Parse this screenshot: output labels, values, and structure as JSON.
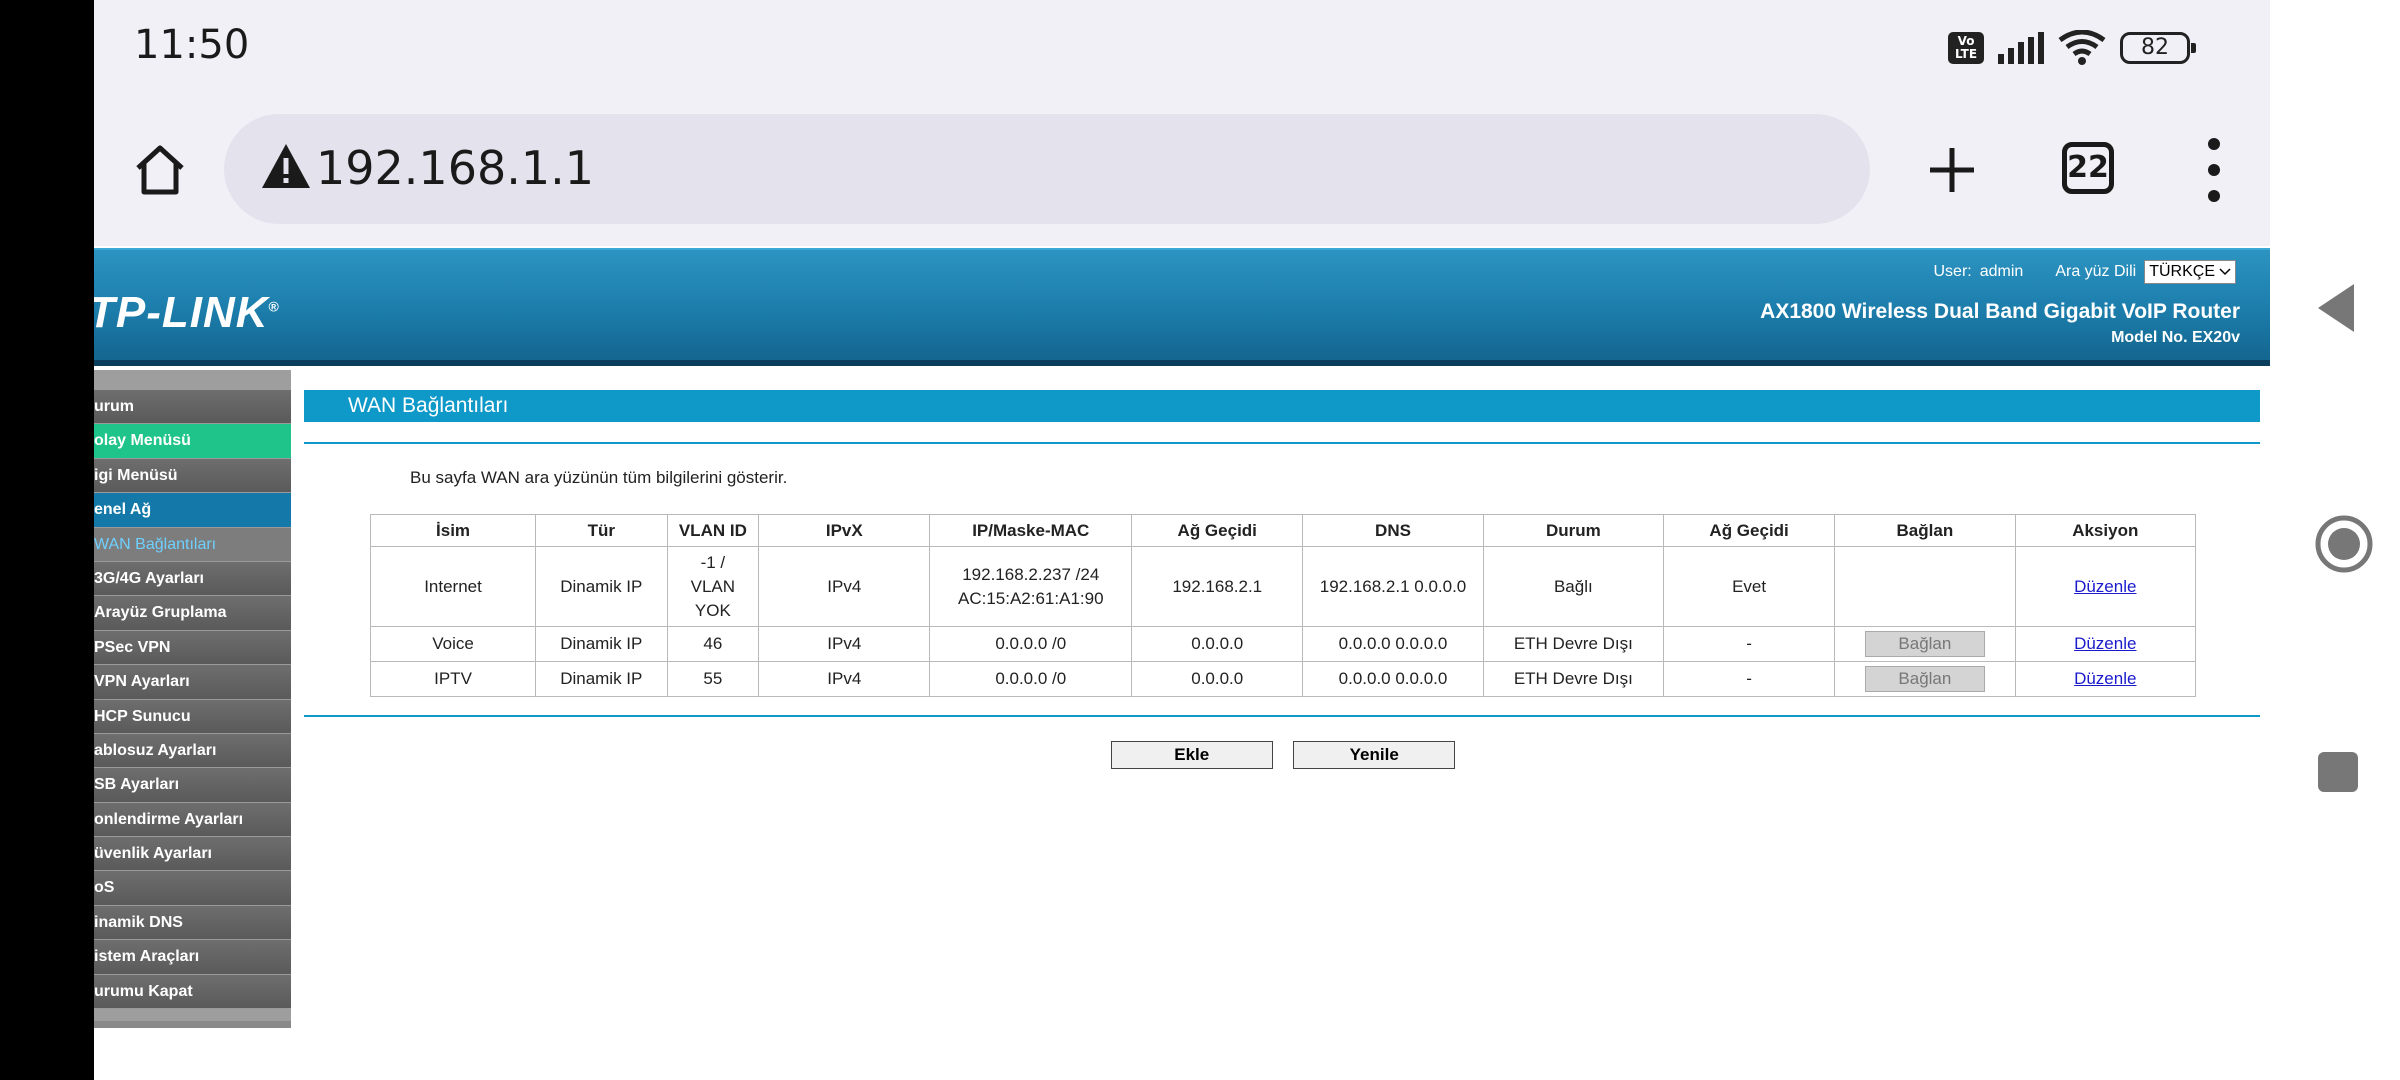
{
  "status_bar": {
    "time": "11:50",
    "volte_label": "Vo LTE",
    "battery": "82"
  },
  "browser": {
    "url": "192.168.1.1",
    "tab_count": "22"
  },
  "router": {
    "user_label": "User:",
    "user_name": "admin",
    "lang_label": "Ara yüz Dili",
    "lang_value": "TÜRKÇE",
    "brand": "TP-LINK",
    "model_title": "AX1800 Wireless Dual Band Gigabit VoIP Router",
    "model_no": "Model No. EX20v"
  },
  "sidebar": {
    "items": [
      {
        "label": "urum",
        "style": "normal"
      },
      {
        "label": "olay Menüsü",
        "style": "green"
      },
      {
        "label": "igi Menüsü",
        "style": "normal"
      },
      {
        "label": "enel Ağ",
        "style": "blue"
      },
      {
        "label": "WAN Bağlantıları",
        "style": "sub"
      },
      {
        "label": "3G/4G Ayarları",
        "style": "normal"
      },
      {
        "label": "Arayüz Gruplama",
        "style": "normal"
      },
      {
        "label": "PSec VPN",
        "style": "normal"
      },
      {
        "label": "VPN Ayarları",
        "style": "normal"
      },
      {
        "label": "HCP Sunucu",
        "style": "normal"
      },
      {
        "label": "ablosuz Ayarları",
        "style": "normal"
      },
      {
        "label": "SB Ayarları",
        "style": "normal"
      },
      {
        "label": "onlendirme Ayarları",
        "style": "normal"
      },
      {
        "label": "üvenlik Ayarları",
        "style": "normal"
      },
      {
        "label": "oS",
        "style": "normal"
      },
      {
        "label": "inamik DNS",
        "style": "normal"
      },
      {
        "label": "istem Araçları",
        "style": "normal"
      },
      {
        "label": "urumu Kapat",
        "style": "normal"
      }
    ]
  },
  "main": {
    "title": "WAN Bağlantıları",
    "description": "Bu sayfa WAN ara yüzünün tüm bilgilerini gösterir.",
    "columns": [
      "İsim",
      "Tür",
      "VLAN ID",
      "IPvX",
      "IP/Maske-MAC",
      "Ağ Geçidi",
      "DNS",
      "Durum",
      "Ağ Geçidi",
      "Bağlan",
      "Aksiyon"
    ],
    "rows": [
      {
        "name": "Internet",
        "type": "Dinamik IP",
        "vlan": [
          "-1 /",
          "VLAN",
          "YOK"
        ],
        "ipvx": "IPv4",
        "ipmask": [
          "192.168.2.237 /24",
          "AC:15:A2:61:A1:90"
        ],
        "gateway": "192.168.2.1",
        "dns": "192.168.2.1 0.0.0.0",
        "status": "Bağlı",
        "default_gw": "Evet",
        "connect": "",
        "action": "Düzenle"
      },
      {
        "name": "Voice",
        "type": "Dinamik IP",
        "vlan": [
          "46"
        ],
        "ipvx": "IPv4",
        "ipmask": [
          "0.0.0.0 /0"
        ],
        "gateway": "0.0.0.0",
        "dns": "0.0.0.0 0.0.0.0",
        "status": "ETH Devre Dışı",
        "default_gw": "-",
        "connect": "Bağlan",
        "action": "Düzenle"
      },
      {
        "name": "IPTV",
        "type": "Dinamik IP",
        "vlan": [
          "55"
        ],
        "ipvx": "IPv4",
        "ipmask": [
          "0.0.0.0 /0"
        ],
        "gateway": "0.0.0.0",
        "dns": "0.0.0.0 0.0.0.0",
        "status": "ETH Devre Dışı",
        "default_gw": "-",
        "connect": "Bağlan",
        "action": "Düzenle"
      }
    ],
    "add_label": "Ekle",
    "refresh_label": "Yenile"
  }
}
